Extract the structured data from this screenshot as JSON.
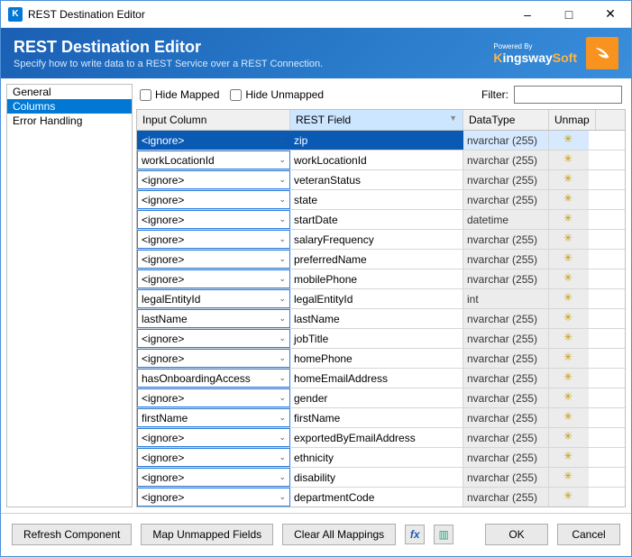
{
  "window": {
    "title": "REST Destination Editor"
  },
  "header": {
    "title": "REST Destination Editor",
    "subtitle": "Specify how to write data to a REST Service over a REST Connection.",
    "powered_by": "Powered By",
    "brand_pre": "K",
    "brand_mid": "ingsway",
    "brand_post": "Soft"
  },
  "sidebar": {
    "items": [
      {
        "label": "General",
        "active": false
      },
      {
        "label": "Columns",
        "active": true
      },
      {
        "label": "Error Handling",
        "active": false
      }
    ]
  },
  "toolbar": {
    "hide_mapped_label": "Hide Mapped",
    "hide_unmapped_label": "Hide Unmapped",
    "hide_mapped_checked": false,
    "hide_unmapped_checked": false,
    "filter_label": "Filter:",
    "filter_value": ""
  },
  "grid": {
    "col_input": "Input Column",
    "col_rest": "REST Field",
    "col_type": "DataType",
    "col_unmap": "Unmap",
    "rows": [
      {
        "input": "<ignore>",
        "rest": "zip",
        "type": "nvarchar (255)",
        "selected": true
      },
      {
        "input": "workLocationId",
        "rest": "workLocationId",
        "type": "nvarchar (255)"
      },
      {
        "input": "<ignore>",
        "rest": "veteranStatus",
        "type": "nvarchar (255)"
      },
      {
        "input": "<ignore>",
        "rest": "state",
        "type": "nvarchar (255)"
      },
      {
        "input": "<ignore>",
        "rest": "startDate",
        "type": "datetime"
      },
      {
        "input": "<ignore>",
        "rest": "salaryFrequency",
        "type": "nvarchar (255)"
      },
      {
        "input": "<ignore>",
        "rest": "preferredName",
        "type": "nvarchar (255)"
      },
      {
        "input": "<ignore>",
        "rest": "mobilePhone",
        "type": "nvarchar (255)"
      },
      {
        "input": "legalEntityId",
        "rest": "legalEntityId",
        "type": "int"
      },
      {
        "input": "lastName",
        "rest": "lastName",
        "type": "nvarchar (255)"
      },
      {
        "input": "<ignore>",
        "rest": "jobTitle",
        "type": "nvarchar (255)"
      },
      {
        "input": "<ignore>",
        "rest": "homePhone",
        "type": "nvarchar (255)"
      },
      {
        "input": "hasOnboardingAccess",
        "rest": "homeEmailAddress",
        "type": "nvarchar (255)"
      },
      {
        "input": "<ignore>",
        "rest": "gender",
        "type": "nvarchar (255)"
      },
      {
        "input": "firstName",
        "rest": "firstName",
        "type": "nvarchar (255)"
      },
      {
        "input": "<ignore>",
        "rest": "exportedByEmailAddress",
        "type": "nvarchar (255)"
      },
      {
        "input": "<ignore>",
        "rest": "ethnicity",
        "type": "nvarchar (255)"
      },
      {
        "input": "<ignore>",
        "rest": "disability",
        "type": "nvarchar (255)"
      },
      {
        "input": "<ignore>",
        "rest": "departmentCode",
        "type": "nvarchar (255)"
      }
    ]
  },
  "footer": {
    "refresh": "Refresh Component",
    "map_unmapped": "Map Unmapped Fields",
    "clear_all": "Clear All Mappings",
    "ok": "OK",
    "cancel": "Cancel"
  }
}
